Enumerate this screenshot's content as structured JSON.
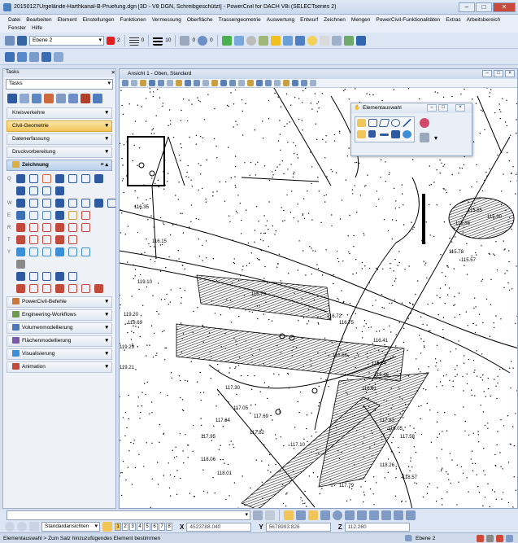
{
  "window": {
    "title": "20150127Urgelände-Harthkanal-B-Pruefung.dgn [3D - V8 DGN, Schreibgeschützt] - PowerCivil for DACH V8i (SELECTseries 2)"
  },
  "menu": [
    "Datei",
    "Bearbeiten",
    "Element",
    "Einstellungen",
    "Funktionen",
    "Vermessung",
    "Oberfläche",
    "Trassengeometrie",
    "Auswertung",
    "Entwurf",
    "Zeichnen",
    "Mengen",
    "PowerCivil-Funktionalitäten",
    "Extras",
    "Arbeitsbereich",
    "Fenster",
    "Hilfe"
  ],
  "attributes_toolbar": {
    "level": "Ebene 2",
    "color_value": "2",
    "line_style_value": "0",
    "line_weight_value": "10",
    "class_value": "0",
    "transparency_value": "0"
  },
  "tasks": {
    "header": "Tasks",
    "selected": "Tasks",
    "sections": [
      {
        "label": "Kreisverkehre",
        "state": "normal"
      },
      {
        "label": "Civil-Geometrie",
        "state": "highlight"
      },
      {
        "label": "Datenerfassung",
        "state": "normal"
      },
      {
        "label": "Druckvorbereitung",
        "state": "normal"
      }
    ],
    "open_section": "Zeichnung",
    "zeichnung_row_letters": [
      "Q",
      "W",
      "E",
      "R",
      "T",
      "Y"
    ],
    "bottom_sections": [
      "PowerCivil-Befehle",
      "Engineering-Workflows",
      "Volumenmodellierung",
      "Flächenmodellierung",
      "Visualisierung",
      "Animation"
    ]
  },
  "view": {
    "title": "Ansicht 1 - Oben, Standard"
  },
  "palette": {
    "title": "Elementauswahl"
  },
  "drawing": {
    "elevation_labels": [
      "115.85",
      "115.78",
      "115.57",
      "115.90",
      "115.86",
      "116.15",
      "116.35",
      "116.72",
      "116.79",
      "116.75",
      "116.41",
      "116.54",
      "116.81",
      "116.46",
      "116.66",
      "117.69",
      "117.64",
      "117.30",
      "117.05",
      "117.82",
      "117.83",
      "117.58",
      "117.10",
      "117.95",
      "117.79",
      "118.01",
      "118.06",
      "118.26",
      "118.57",
      "118.05",
      "119.10",
      "119.20",
      "119.29",
      "119.69",
      "119.21"
    ],
    "line_color": "#000000"
  },
  "bottom": {
    "view_attributes_label": "Standardansichten",
    "view_numbers": [
      "1",
      "2",
      "3",
      "4",
      "5",
      "6",
      "7",
      "8"
    ],
    "x_label": "X",
    "x_value": "4523788.040",
    "y_label": "Y",
    "y_value": "5678993.826",
    "z_label": "Z",
    "z_value": "112.260"
  },
  "status": {
    "message": "Elementauswahl > Zum Satz hinzuzufügendes Element bestimmen",
    "level": "Ebene 2"
  },
  "colors": {
    "accent_orange": "#f2c55a",
    "chrome_blue": "#d6dfee",
    "active_color_swatch": "#e02020"
  }
}
